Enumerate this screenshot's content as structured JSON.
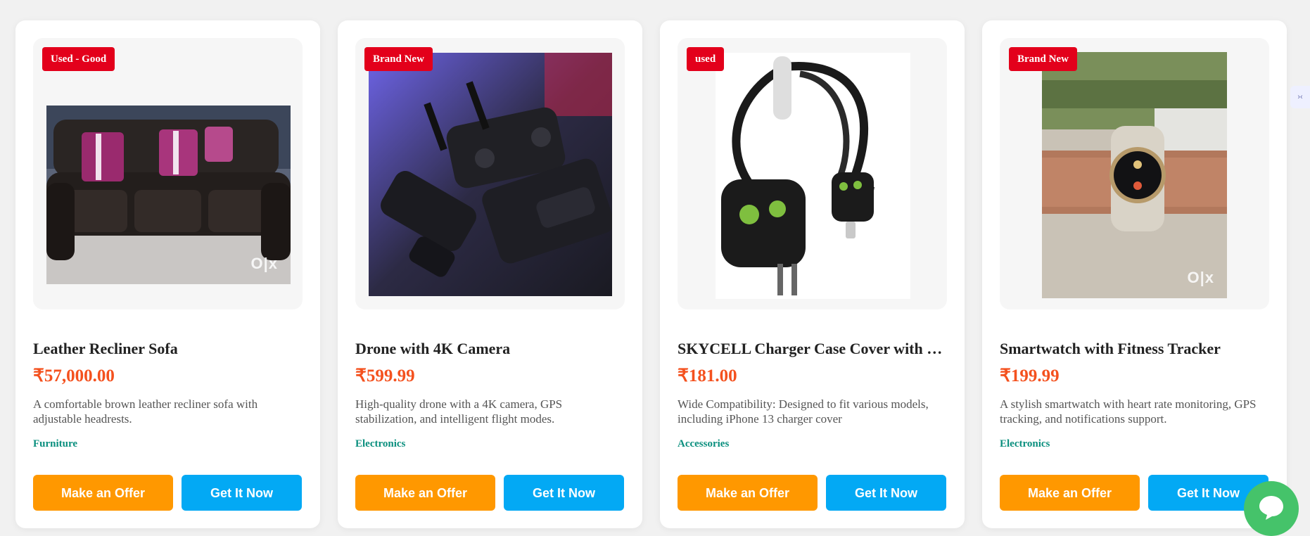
{
  "products": [
    {
      "badge": "Used - Good",
      "title": "Leather Recliner Sofa",
      "price": "₹57,000.00",
      "description": "A comfortable brown leather recliner sofa with adjustable headrests.",
      "category": "Furniture",
      "offer_label": "Make an Offer",
      "buy_label": "Get It Now"
    },
    {
      "badge": "Brand New",
      "title": "Drone with 4K Camera",
      "price": "₹599.99",
      "description": "High-quality drone with a 4K camera, GPS stabilization, and intelligent flight modes.",
      "category": "Electronics",
      "offer_label": "Make an Offer",
      "buy_label": "Get It Now"
    },
    {
      "badge": "used",
      "title": "SKYCELL Charger Case Cover with Cable Protector",
      "price": "₹181.00",
      "description": "Wide Compatibility: Designed to fit various models, including iPhone 13 charger cover",
      "category": "Accessories",
      "offer_label": "Make an Offer",
      "buy_label": "Get It Now"
    },
    {
      "badge": "Brand New",
      "title": "Smartwatch with Fitness Tracker",
      "price": "₹199.99",
      "description": "A stylish smartwatch with heart rate monitoring, GPS tracking, and notifications support.",
      "category": "Electronics",
      "offer_label": "Make an Offer",
      "buy_label": "Get It Now"
    }
  ],
  "watermark": "O|x",
  "side_tab_glyph": "›‹",
  "colors": {
    "badge": "#e3001b",
    "price": "#f4511e",
    "category": "#0a8f7e",
    "offer_button": "#ff9800",
    "buy_button": "#03a9f4",
    "chat_button": "#45c36a"
  }
}
